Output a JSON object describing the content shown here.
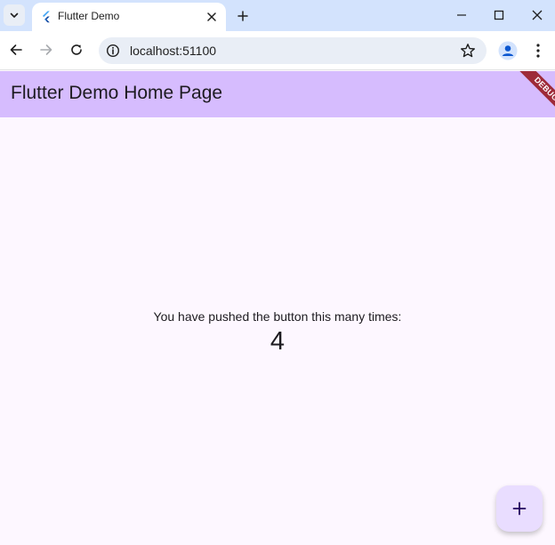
{
  "browser": {
    "tab": {
      "title": "Flutter Demo"
    },
    "address": {
      "url": "localhost:51100"
    }
  },
  "app": {
    "appbar": {
      "title": "Flutter Demo Home Page",
      "debug_label": "DEBUG"
    },
    "body": {
      "label": "You have pushed the button this many times:",
      "count": "4"
    },
    "fab": {
      "icon": "plus-icon"
    }
  },
  "colors": {
    "tabstrip": "#d3e3fd",
    "appbar": "#d6bcfe",
    "background": "#fdf7ff",
    "fab": "#e9ddff",
    "debug_banner": "#9e2b39"
  }
}
